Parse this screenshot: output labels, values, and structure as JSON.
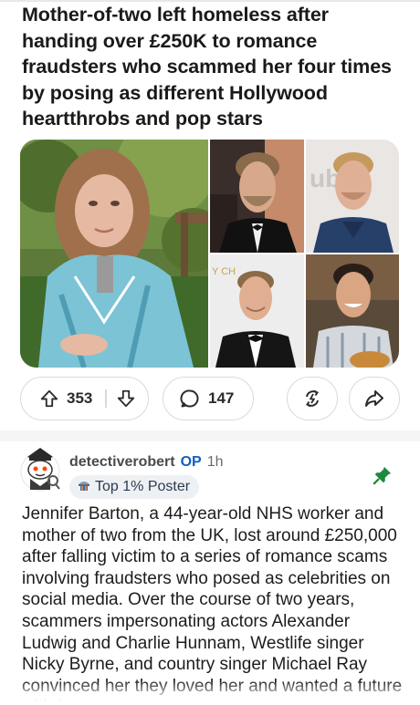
{
  "post": {
    "title": "Mother-of-two left homeless after handing over £250K to romance fraudsters who scammed her four times by posing as different Hollywood heartthrobs and pop stars",
    "upvotes": "353",
    "comments": "147"
  },
  "comment": {
    "author": "detectiverobert",
    "op_badge": "OP",
    "time": "1h",
    "flair": "Top 1% Poster",
    "body": "Jennifer Barton, a 44-year-old NHS worker and mother of two from the UK, lost around £250,000 after falling victim to a series of romance scams involving fraudsters who posed as celebrities on social media. Over the course of two years, scammers impersonating actors Alexander Ludwig and Charlie Hunnam, Westlife singer Nicky Byrne, and country singer Michael Ray convinced her they loved her and wanted a future with her."
  },
  "colors": {
    "op_blue": "#0f5fc6",
    "pin_green": "#1b8a3c",
    "border": "#d8dadc"
  },
  "icons": [
    "upvote-icon",
    "downvote-icon",
    "comment-icon",
    "award-icon",
    "share-icon",
    "pin-icon",
    "flair-icon"
  ]
}
